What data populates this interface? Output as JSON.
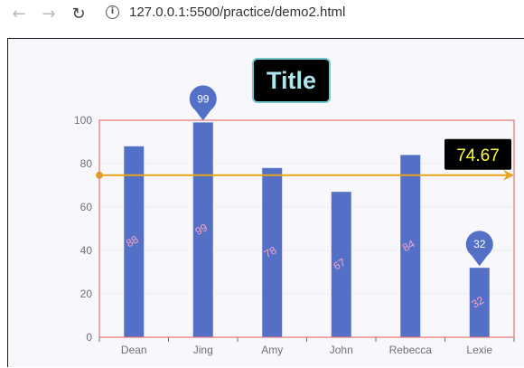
{
  "browser": {
    "url": "127.0.0.1:5500/practice/demo2.html",
    "back_icon": "arrow-left-icon",
    "forward_icon": "arrow-right-icon",
    "reload_icon": "reload-icon",
    "info_icon": "info-icon"
  },
  "chart_data": {
    "type": "bar",
    "title": "Title",
    "categories": [
      "Dean",
      "Jing",
      "Amy",
      "John",
      "Rebecca",
      "Lexie"
    ],
    "values": [
      88,
      99,
      78,
      67,
      84,
      32
    ],
    "ylim": [
      0,
      100
    ],
    "yticks": [
      0,
      20,
      40,
      60,
      80,
      100
    ],
    "mark_points": [
      {
        "name": "max",
        "category": "Jing",
        "value": 99,
        "label": "99"
      },
      {
        "name": "min",
        "category": "Lexie",
        "value": 32,
        "label": "32"
      }
    ],
    "mark_line": {
      "type": "average",
      "value": 74.67,
      "label": "74.67"
    },
    "grid": false,
    "colors": {
      "bar": "#5470c6",
      "bar_label": "#f4a7c7",
      "title_bg": "#000000",
      "title_text": "#aee6ee",
      "title_border": "#70c8cc",
      "mark_line": "#e5a51b",
      "mark_line_label_bg": "#000000",
      "mark_line_label_text": "#ffff33",
      "grid_border": "#e87575",
      "axis": "#6e7079"
    }
  }
}
